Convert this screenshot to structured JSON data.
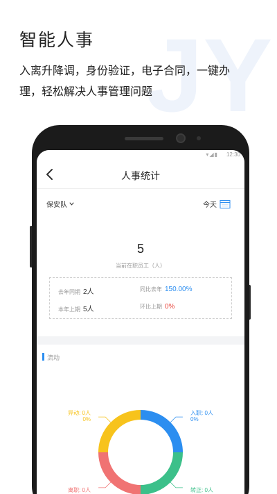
{
  "promo": {
    "title": "智能人事",
    "desc_line1": "入离升降调，身份验证，电子合同，一键办",
    "desc_line2": "理，轻松解决人事管理问题"
  },
  "status_bar": {
    "time": "12:30"
  },
  "nav": {
    "title": "人事统计"
  },
  "filters": {
    "team": "保安队",
    "date": "今天"
  },
  "summary": {
    "count": "5",
    "count_label": "当前在职员工（人）"
  },
  "stats": [
    {
      "label": "去年同期",
      "value": "2人",
      "tone": "normal"
    },
    {
      "label": "同比去年",
      "value": "150.00%",
      "tone": "blue"
    },
    {
      "label": "本年上期",
      "value": "5人",
      "tone": "normal"
    },
    {
      "label": "环比上期",
      "value": "0%",
      "tone": "red"
    }
  ],
  "section": {
    "title": "流动"
  },
  "flow": {
    "onboard_label": "入职: 0人",
    "onboard_pct": "0%",
    "transfer_label": "异动: 0人",
    "transfer_pct": "0%",
    "resign_label": "离职: 0人",
    "promote_label": "转正: 0人"
  },
  "colors": {
    "onboard": "#2c8ef0",
    "promote": "#3cc08a",
    "resign": "#f07373",
    "transfer": "#f7c31c",
    "accent_blue": "#2c8ef0",
    "accent_red": "#e8453c"
  },
  "chart_data": {
    "type": "pie",
    "categories": [
      "入职",
      "转正",
      "离职",
      "异动"
    ],
    "values": [
      0,
      0,
      0,
      0
    ]
  }
}
